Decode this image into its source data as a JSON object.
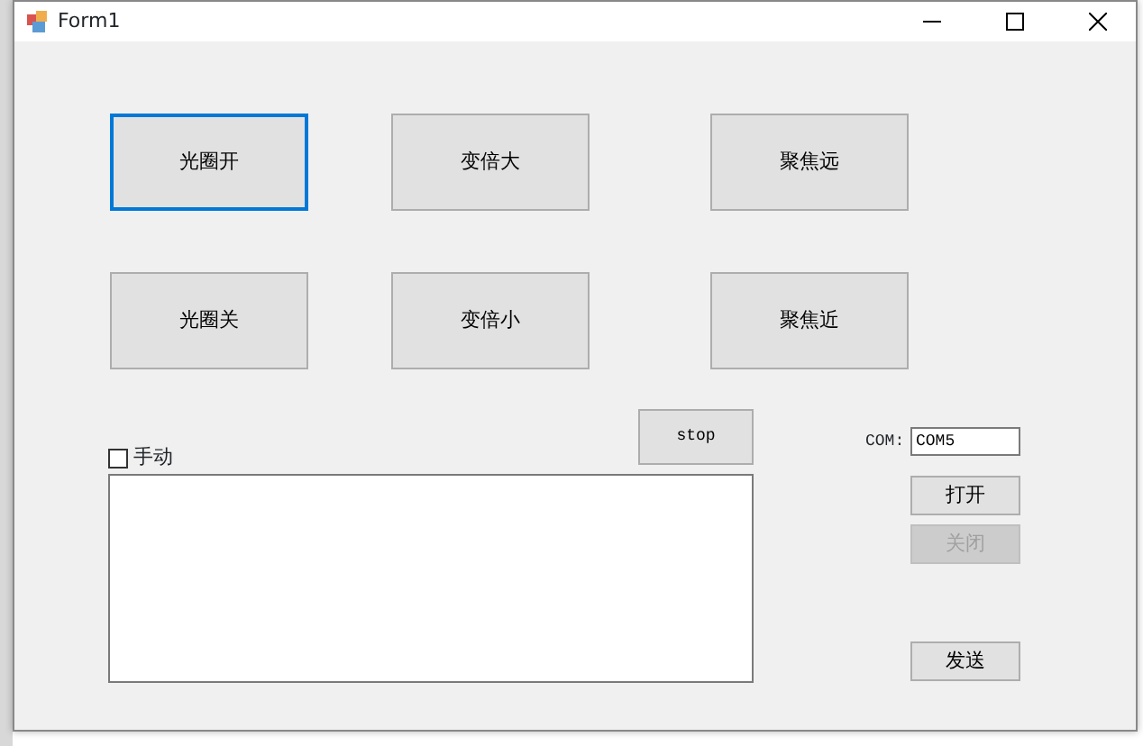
{
  "window": {
    "title": "Form1"
  },
  "lens_buttons": [
    {
      "label": "光圈开",
      "focused": true
    },
    {
      "label": "变倍大",
      "focused": false
    },
    {
      "label": "聚焦远",
      "focused": false
    },
    {
      "label": "光圈关",
      "focused": false
    },
    {
      "label": "变倍小",
      "focused": false
    },
    {
      "label": "聚焦近",
      "focused": false
    }
  ],
  "stop_button": {
    "label": "stop"
  },
  "manual_checkbox": {
    "label": "手动",
    "checked": false
  },
  "com": {
    "label": "COM:",
    "value": "COM5"
  },
  "port_buttons": [
    {
      "label": "打开",
      "disabled": false
    },
    {
      "label": "关闭",
      "disabled": true
    }
  ],
  "send_button": {
    "label": "发送"
  }
}
